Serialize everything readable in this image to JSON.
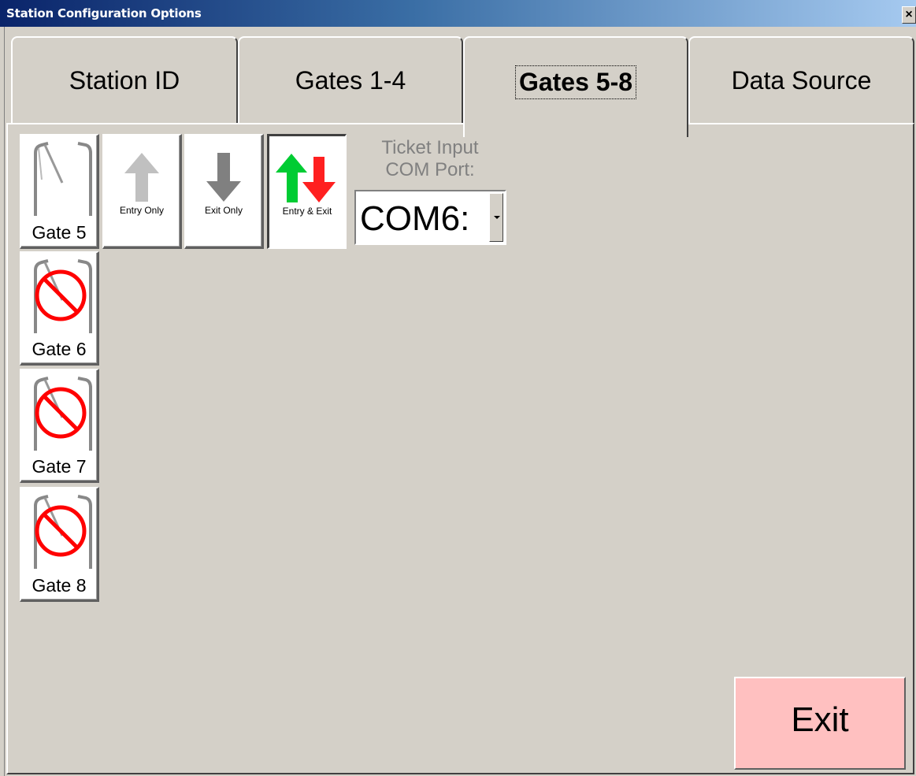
{
  "window": {
    "title": "Station Configuration Options",
    "close_label": "×"
  },
  "tabs": [
    {
      "label": "Station ID"
    },
    {
      "label": "Gates 1-4"
    },
    {
      "label": "Gates 5-8",
      "selected": true
    },
    {
      "label": "Data Source"
    }
  ],
  "gates": [
    {
      "label": "Gate 5",
      "enabled": true
    },
    {
      "label": "Gate 6",
      "enabled": false
    },
    {
      "label": "Gate 7",
      "enabled": false
    },
    {
      "label": "Gate 8",
      "enabled": false
    }
  ],
  "direction": {
    "entry_only": "Entry Only",
    "exit_only": "Exit Only",
    "entry_exit": "Entry & Exit",
    "selected": "Entry & Exit"
  },
  "ticket_input": {
    "label_line1": "Ticket Input",
    "label_line2": "COM Port:",
    "value": "COM6:"
  },
  "exit_button": "Exit",
  "colors": {
    "exit_bg": "#ffc0c0",
    "entry_arrow": "#00cc33",
    "exit_arrow": "#ff2020",
    "disabled_ring": "#ff0000"
  }
}
